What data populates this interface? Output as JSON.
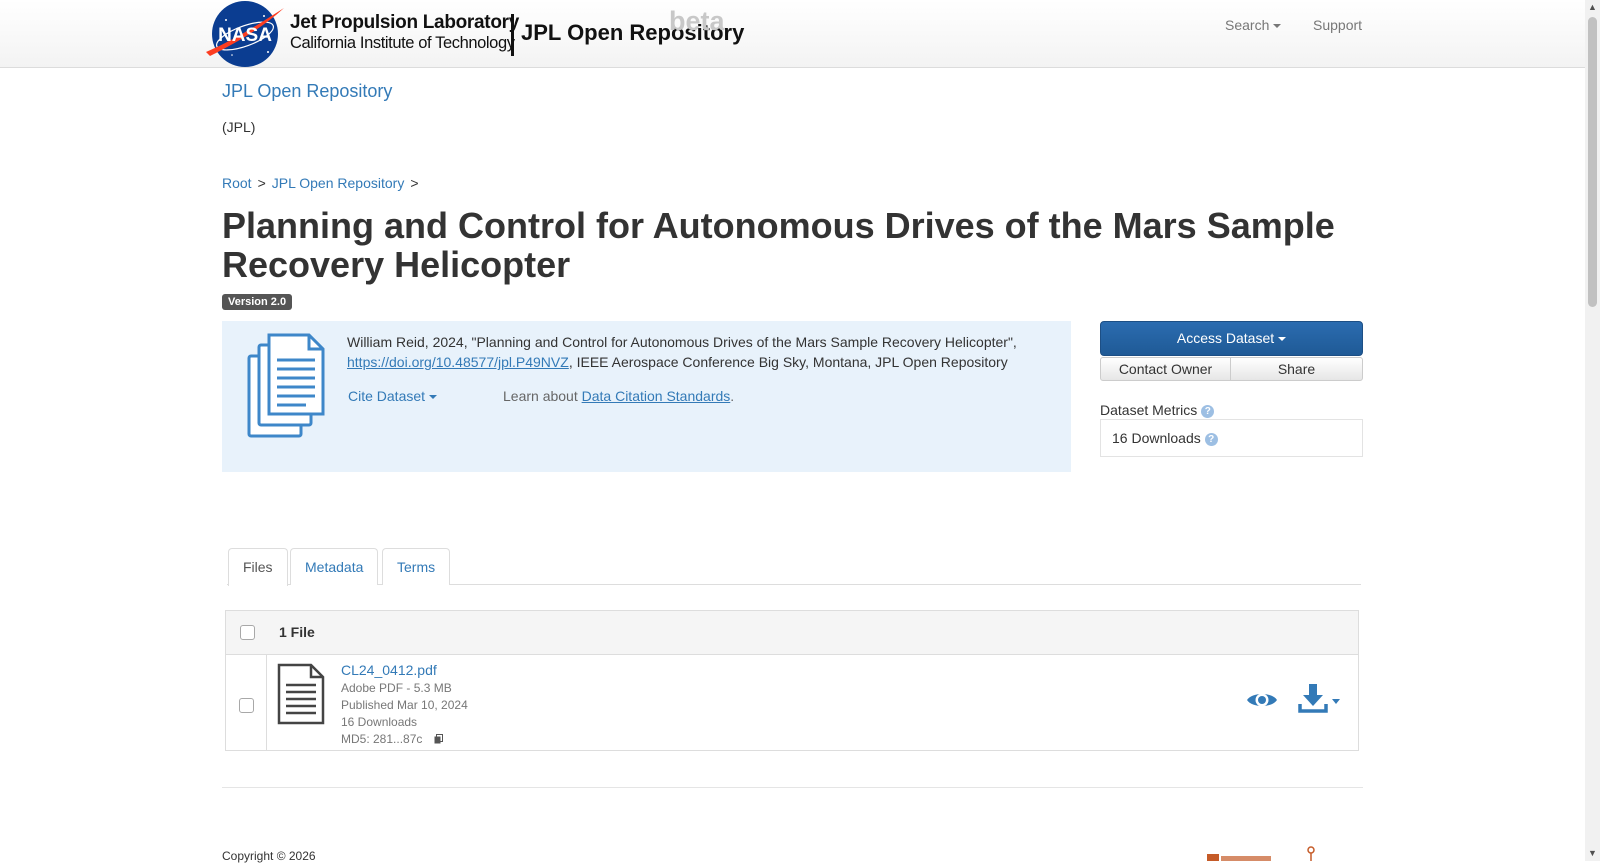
{
  "navbar": {
    "logo_text": "NASA",
    "lab_name": "Jet Propulsion Laboratory",
    "institute": "California Institute of Technology",
    "repo_name": "JPL Open Repository",
    "beta": "beta",
    "search_label": "Search",
    "support_label": "Support"
  },
  "dataverse": {
    "title": "JPL Open Repository",
    "affiliation": "(JPL)"
  },
  "breadcrumb": {
    "items": [
      "Root",
      "JPL Open Repository"
    ],
    "separator": ">"
  },
  "dataset": {
    "title": "Planning and Control for Autonomous Drives of the Mars Sample Recovery Helicopter",
    "version": "Version 2.0",
    "citation_prefix": "William Reid, 2024, \"Planning and Control for Autonomous Drives of the Mars Sample Recovery Helicopter\", ",
    "citation_doi": "https://doi.org/10.48577/jpl.P49NVZ",
    "citation_suffix": ", IEEE Aerospace Conference Big Sky, Montana, JPL Open Repository",
    "cite_label": "Cite Dataset",
    "learn_prefix": "Learn about ",
    "learn_link": "Data Citation Standards",
    "learn_suffix": "."
  },
  "actions": {
    "access_label": "Access Dataset",
    "contact_label": "Contact Owner",
    "share_label": "Share"
  },
  "metrics": {
    "label": "Dataset Metrics",
    "downloads": "16 Downloads"
  },
  "tabs": [
    {
      "label": "Files",
      "active": true
    },
    {
      "label": "Metadata",
      "active": false
    },
    {
      "label": "Terms",
      "active": false
    }
  ],
  "files": {
    "count_label": "1 File",
    "rows": [
      {
        "name": "CL24_0412.pdf",
        "type_size": "Adobe PDF - 5.3 MB",
        "published": "Published Mar 10, 2024",
        "downloads": "16 Downloads",
        "md5": "MD5: 281...87c"
      }
    ]
  },
  "footer": {
    "copyright": "Copyright © 2026"
  },
  "colors": {
    "link": "#337ab7",
    "primary_button": "#286090",
    "citation_bg": "#e8f2fb",
    "badge": "#555555"
  },
  "icons": [
    "nasa-logo",
    "chevron-down-icon",
    "document-stack-icon",
    "help-icon",
    "file-icon",
    "copy-icon",
    "eye-icon",
    "download-icon"
  ]
}
